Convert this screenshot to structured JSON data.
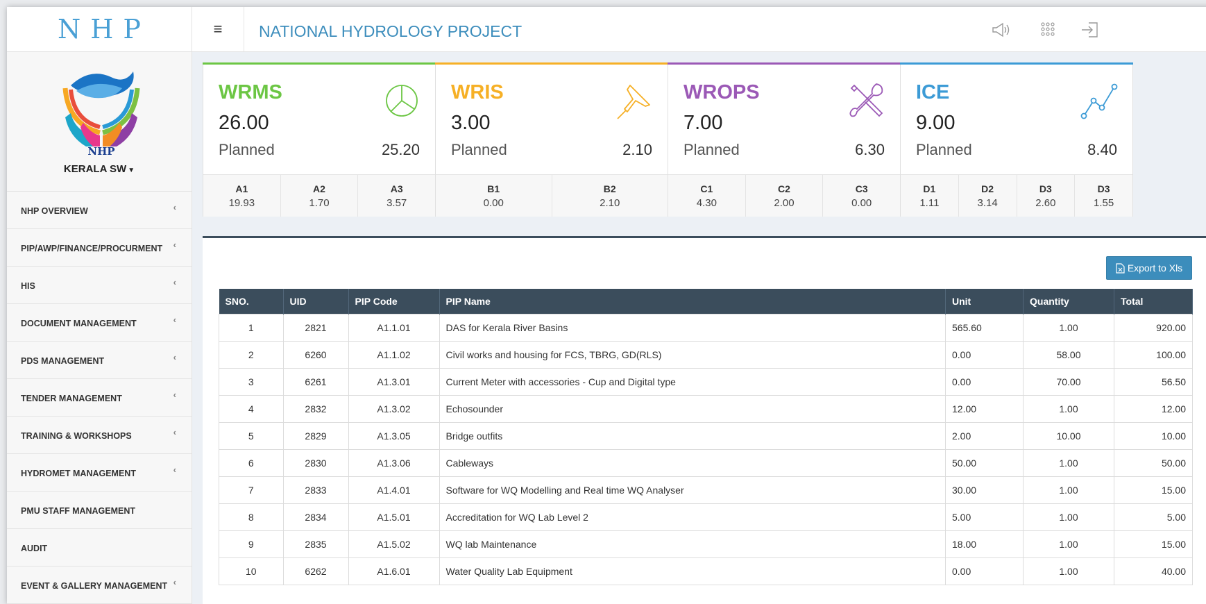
{
  "app": {
    "logo": "NHP",
    "title": "NATIONAL HYDROLOGY PROJECT"
  },
  "sidebar": {
    "org_logo_text": "NHP",
    "user": "KERALA SW",
    "items": [
      {
        "label": "NHP OVERVIEW",
        "chevron": "‹"
      },
      {
        "label": "PIP/AWP/FINANCE/PROCURMENT",
        "chevron": "‹"
      },
      {
        "label": "HIS",
        "chevron": "‹"
      },
      {
        "label": "DOCUMENT MANAGEMENT",
        "chevron": "‹"
      },
      {
        "label": "PDS MANAGEMENT",
        "chevron": "‹"
      },
      {
        "label": "TENDER MANAGEMENT",
        "chevron": "‹"
      },
      {
        "label": "TRAINING & WORKSHOPS",
        "chevron": "‹"
      },
      {
        "label": "HYDROMET MANAGEMENT",
        "chevron": "‹"
      },
      {
        "label": "PMU STAFF MANAGEMENT",
        "chevron": ""
      },
      {
        "label": "AUDIT",
        "chevron": ""
      },
      {
        "label": "EVENT & GALLERY MANAGEMENT",
        "chevron": "‹"
      }
    ]
  },
  "header": {
    "menu_icon": "hamburger-icon",
    "icons": [
      "megaphone-icon",
      "apps-grid-icon",
      "logout-icon"
    ]
  },
  "cards": [
    {
      "title": "WRMS",
      "value": "26.00",
      "planned_label": "Planned",
      "planned": "25.20",
      "color": "#6cc644",
      "icon": "pie-chart-icon",
      "subs": [
        {
          "label": "A1",
          "value": "19.93"
        },
        {
          "label": "A2",
          "value": "1.70"
        },
        {
          "label": "A3",
          "value": "3.57"
        }
      ]
    },
    {
      "title": "WRIS",
      "value": "3.00",
      "planned_label": "Planned",
      "planned": "2.10",
      "color": "#f6b026",
      "icon": "pin-icon",
      "subs": [
        {
          "label": "B1",
          "value": "0.00"
        },
        {
          "label": "B2",
          "value": "2.10"
        }
      ]
    },
    {
      "title": "WROPS",
      "value": "7.00",
      "planned_label": "Planned",
      "planned": "6.30",
      "color": "#9b59b6",
      "icon": "tools-icon",
      "subs": [
        {
          "label": "C1",
          "value": "4.30"
        },
        {
          "label": "C2",
          "value": "2.00"
        },
        {
          "label": "C3",
          "value": "0.00"
        }
      ]
    },
    {
      "title": "ICE",
      "value": "9.00",
      "planned_label": "Planned",
      "planned": "8.40",
      "color": "#3c9bd6",
      "icon": "line-chart-icon",
      "subs": [
        {
          "label": "D1",
          "value": "1.11"
        },
        {
          "label": "D2",
          "value": "3.14"
        },
        {
          "label": "D3",
          "value": "2.60"
        },
        {
          "label": "D3",
          "value": "1.55"
        }
      ]
    }
  ],
  "table": {
    "export_label": "Export to Xls",
    "columns": [
      "SNO.",
      "UID",
      "PIP Code",
      "PIP Name",
      "Unit",
      "Quantity",
      "Total"
    ],
    "rows": [
      [
        "1",
        "2821",
        "A1.1.01",
        "DAS for Kerala River Basins",
        "565.60",
        "1.00",
        "920.00"
      ],
      [
        "2",
        "6260",
        "A1.1.02",
        "Civil works and housing for FCS, TBRG, GD(RLS)",
        "0.00",
        "58.00",
        "100.00"
      ],
      [
        "3",
        "6261",
        "A1.3.01",
        "Current Meter with accessories - Cup and Digital type",
        "0.00",
        "70.00",
        "56.50"
      ],
      [
        "4",
        "2832",
        "A1.3.02",
        "Echosounder",
        "12.00",
        "1.00",
        "12.00"
      ],
      [
        "5",
        "2829",
        "A1.3.05",
        "Bridge outfits",
        "2.00",
        "10.00",
        "10.00"
      ],
      [
        "6",
        "2830",
        "A1.3.06",
        "Cableways",
        "50.00",
        "1.00",
        "50.00"
      ],
      [
        "7",
        "2833",
        "A1.4.01",
        "Software for WQ Modelling and Real time WQ Analyser",
        "30.00",
        "1.00",
        "15.00"
      ],
      [
        "8",
        "2834",
        "A1.5.01",
        "Accreditation for WQ Lab Level 2",
        "5.00",
        "1.00",
        "5.00"
      ],
      [
        "9",
        "2835",
        "A1.5.02",
        "WQ lab Maintenance",
        "18.00",
        "1.00",
        "15.00"
      ],
      [
        "10",
        "6262",
        "A1.6.01",
        "Water Quality Lab Equipment",
        "0.00",
        "1.00",
        "40.00"
      ]
    ]
  }
}
